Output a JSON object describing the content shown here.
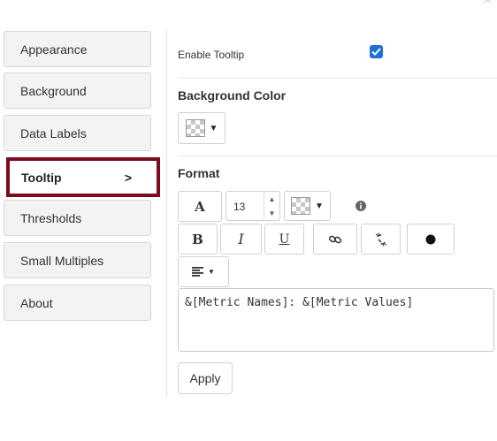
{
  "close_glyph": "×",
  "sidebar": {
    "items": [
      {
        "label": "Appearance"
      },
      {
        "label": "Background"
      },
      {
        "label": "Data Labels"
      },
      {
        "label": "Tooltip",
        "active": true,
        "indicator": ">"
      },
      {
        "label": "Thresholds"
      },
      {
        "label": "Small Multiples"
      },
      {
        "label": "About"
      }
    ]
  },
  "tooltip_settings": {
    "enable_label": "Enable Tooltip",
    "enabled": true,
    "background_color_heading": "Background Color",
    "format_heading": "Format",
    "font_size": "13",
    "font_icon": "A",
    "bold_icon": "B",
    "italic_icon": "I",
    "underline_icon": "U",
    "template_text": "&[Metric Names]: &[Metric Values]",
    "apply_label": "Apply"
  },
  "icons": {
    "info": "info-icon",
    "link": "link-icon",
    "unlink": "unlink-icon",
    "bullet": "circle-icon",
    "align": "align-left-icon"
  },
  "colors": {
    "active_border": "#7d0a1f",
    "checkbox": "#1e6fd6"
  }
}
